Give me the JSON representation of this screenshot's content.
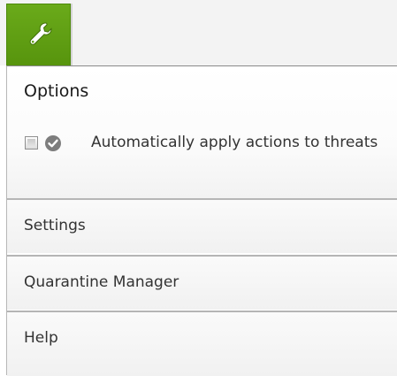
{
  "header": {
    "tool_icon": "wrench-icon",
    "accent_color": "#5fa014"
  },
  "options": {
    "title": "Options",
    "auto_apply": {
      "label": "Automatically apply actions to threats",
      "checked": false,
      "icon": "check-circle-icon"
    }
  },
  "menu": {
    "items": [
      {
        "label": "Settings"
      },
      {
        "label": "Quarantine Manager"
      },
      {
        "label": "Help"
      }
    ]
  }
}
